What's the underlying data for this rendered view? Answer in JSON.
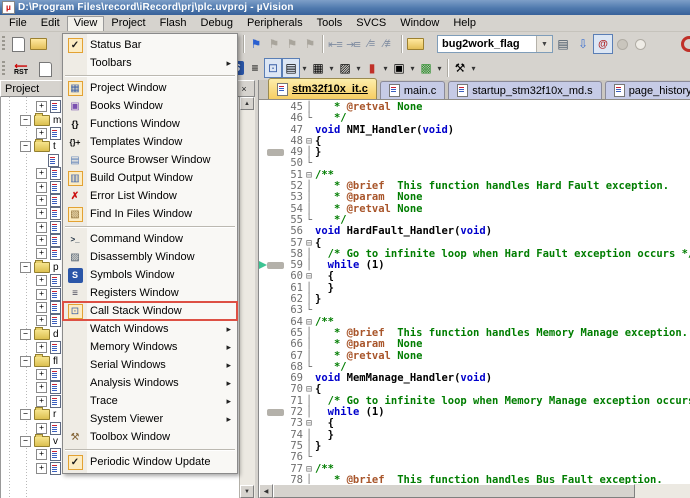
{
  "window": {
    "title": "D:\\Program Files\\record\\iRecord\\prj\\plc.uvproj - µVision"
  },
  "menubar": {
    "items": [
      "File",
      "Edit",
      "View",
      "Project",
      "Flash",
      "Debug",
      "Peripherals",
      "Tools",
      "SVCS",
      "Window",
      "Help"
    ],
    "active": "View"
  },
  "icons": {
    "check": "✓",
    "submenu-arrow": "▸",
    "flag": "⚑",
    "registers": "≡",
    "project": "▦",
    "books": "▣",
    "functions": "{}",
    "templates": "{}+",
    "source-browser": "▤",
    "build-output": "▥",
    "error-list": "✗",
    "find-in-files": "▧",
    "command": ">_",
    "disassembly": "▨",
    "symbols": "S",
    "call-stack": "⊡",
    "toolbox": "⚒",
    "pin": "↧",
    "close": "×",
    "up": "▲",
    "down": "▼",
    "left": "◀",
    "dropdown": "▾",
    "editmarkers": "≣",
    "grid": "▦",
    "watch": "▤",
    "memory": "▥",
    "serial": "▨",
    "analysis": "▮",
    "sysviewer": "▣",
    "chip": "▩",
    "wrench": "⚒",
    "docfind": "▤",
    "bluearrow": "⇩",
    "magat": "@",
    "newdoc": "",
    "openfolder": "",
    "loadfolder": "⚑"
  },
  "toolbar_main": {
    "combo_value": "bug2work_flag"
  },
  "toolbar_debug": {
    "rst_label": "RST"
  },
  "project_panel": {
    "title": "Project",
    "tree": [
      {
        "type": "file",
        "exp": "plus",
        "lvl": 2,
        "label": ""
      },
      {
        "type": "folder",
        "exp": "minus",
        "lvl": 1,
        "label": "m"
      },
      {
        "type": "file",
        "exp": "plus",
        "lvl": 2,
        "label": ""
      },
      {
        "type": "folder",
        "exp": "minus",
        "lvl": 1,
        "label": "t"
      },
      {
        "type": "file",
        "exp": null,
        "lvl": 2,
        "label": ""
      },
      {
        "type": "file",
        "exp": "plus",
        "lvl": 2,
        "label": ""
      },
      {
        "type": "file",
        "exp": "plus",
        "lvl": 2,
        "label": ""
      },
      {
        "type": "file",
        "exp": "plus",
        "lvl": 2,
        "label": ""
      },
      {
        "type": "file",
        "exp": "plus",
        "lvl": 2,
        "label": ""
      },
      {
        "type": "file",
        "exp": "plus",
        "lvl": 2,
        "label": ""
      },
      {
        "type": "file",
        "exp": "plus",
        "lvl": 2,
        "label": ""
      },
      {
        "type": "file",
        "exp": "plus",
        "lvl": 2,
        "label": ""
      },
      {
        "type": "folder",
        "exp": "minus",
        "lvl": 1,
        "label": "p"
      },
      {
        "type": "file",
        "exp": "plus",
        "lvl": 2,
        "label": ""
      },
      {
        "type": "file",
        "exp": "plus",
        "lvl": 2,
        "label": ""
      },
      {
        "type": "file",
        "exp": "plus",
        "lvl": 2,
        "label": ""
      },
      {
        "type": "file",
        "exp": "plus",
        "lvl": 2,
        "label": ""
      },
      {
        "type": "folder",
        "exp": "minus",
        "lvl": 1,
        "label": "d"
      },
      {
        "type": "file",
        "exp": "plus",
        "lvl": 2,
        "label": ""
      },
      {
        "type": "folder",
        "exp": "minus",
        "lvl": 1,
        "label": "fl"
      },
      {
        "type": "file",
        "exp": "plus",
        "lvl": 2,
        "label": ""
      },
      {
        "type": "file",
        "exp": "plus",
        "lvl": 2,
        "label": ""
      },
      {
        "type": "file",
        "exp": "plus",
        "lvl": 2,
        "label": ""
      },
      {
        "type": "folder",
        "exp": "minus",
        "lvl": 1,
        "label": "r"
      },
      {
        "type": "file",
        "exp": "plus",
        "lvl": 2,
        "label": ""
      },
      {
        "type": "folder",
        "exp": "minus",
        "lvl": 1,
        "label": "v"
      },
      {
        "type": "file",
        "exp": "plus",
        "lvl": 2,
        "label": ""
      },
      {
        "type": "file",
        "exp": "plus",
        "lvl": 2,
        "label": ""
      }
    ]
  },
  "editor": {
    "tabs": [
      {
        "label": "stm32f10x_it.c",
        "active": true
      },
      {
        "label": "main.c",
        "active": false
      },
      {
        "label": "startup_stm32f10x_md.s",
        "active": false
      },
      {
        "label": "page_history.c",
        "active": false
      }
    ],
    "lines": [
      {
        "n": 45,
        "fold": "v",
        "tok": [
          [
            "c",
            "   * "
          ],
          [
            "d",
            "@retval"
          ],
          [
            "c",
            " None"
          ]
        ]
      },
      {
        "n": 46,
        "fold": "e",
        "tok": [
          [
            "c",
            "   */"
          ]
        ]
      },
      {
        "n": 47,
        "fold": "",
        "tok": [
          [
            "k",
            "void"
          ],
          [
            "p",
            " NMI_Handler("
          ],
          [
            "k",
            "void"
          ],
          [
            "p",
            ")"
          ]
        ]
      },
      {
        "n": 48,
        "fold": "o",
        "tok": [
          [
            "p",
            "{"
          ]
        ]
      },
      {
        "n": 49,
        "fold": "v",
        "mark": "block",
        "tok": [
          [
            "p",
            "}"
          ]
        ]
      },
      {
        "n": 50,
        "fold": "e",
        "tok": []
      },
      {
        "n": 51,
        "fold": "o",
        "tok": [
          [
            "c",
            "/**"
          ]
        ]
      },
      {
        "n": 52,
        "fold": "v",
        "tok": [
          [
            "c",
            "   * "
          ],
          [
            "d",
            "@brief"
          ],
          [
            "c",
            "  This function handles Hard Fault exception."
          ]
        ]
      },
      {
        "n": 53,
        "fold": "v",
        "tok": [
          [
            "c",
            "   * "
          ],
          [
            "d",
            "@param"
          ],
          [
            "c",
            "  None"
          ]
        ]
      },
      {
        "n": 54,
        "fold": "v",
        "tok": [
          [
            "c",
            "   * "
          ],
          [
            "d",
            "@retval"
          ],
          [
            "c",
            " None"
          ]
        ]
      },
      {
        "n": 55,
        "fold": "e",
        "tok": [
          [
            "c",
            "   */"
          ]
        ]
      },
      {
        "n": 56,
        "fold": "",
        "tok": [
          [
            "k",
            "void"
          ],
          [
            "p",
            " HardFault_Handler("
          ],
          [
            "k",
            "void"
          ],
          [
            "p",
            ")"
          ]
        ]
      },
      {
        "n": 57,
        "fold": "o",
        "tok": [
          [
            "p",
            "{"
          ]
        ]
      },
      {
        "n": 58,
        "fold": "v",
        "tok": [
          [
            "c",
            "  /* Go to infinite loop when Hard Fault exception occurs */"
          ]
        ]
      },
      {
        "n": 59,
        "fold": "v",
        "mark": "arrow",
        "tok": [
          [
            "p",
            "  "
          ],
          [
            "k",
            "while"
          ],
          [
            "p",
            " (1)"
          ]
        ]
      },
      {
        "n": 60,
        "fold": "o",
        "tok": [
          [
            "p",
            "  {"
          ]
        ]
      },
      {
        "n": 61,
        "fold": "v",
        "tok": [
          [
            "p",
            "  }"
          ]
        ]
      },
      {
        "n": 62,
        "fold": "v",
        "tok": [
          [
            "p",
            "}"
          ]
        ]
      },
      {
        "n": 63,
        "fold": "e",
        "tok": []
      },
      {
        "n": 64,
        "fold": "o",
        "tok": [
          [
            "c",
            "/**"
          ]
        ]
      },
      {
        "n": 65,
        "fold": "v",
        "tok": [
          [
            "c",
            "   * "
          ],
          [
            "d",
            "@brief"
          ],
          [
            "c",
            "  This function handles Memory Manage exception."
          ]
        ]
      },
      {
        "n": 66,
        "fold": "v",
        "tok": [
          [
            "c",
            "   * "
          ],
          [
            "d",
            "@param"
          ],
          [
            "c",
            "  None"
          ]
        ]
      },
      {
        "n": 67,
        "fold": "v",
        "tok": [
          [
            "c",
            "   * "
          ],
          [
            "d",
            "@retval"
          ],
          [
            "c",
            " None"
          ]
        ]
      },
      {
        "n": 68,
        "fold": "e",
        "tok": [
          [
            "c",
            "   */"
          ]
        ]
      },
      {
        "n": 69,
        "fold": "",
        "tok": [
          [
            "k",
            "void"
          ],
          [
            "p",
            " MemManage_Handler("
          ],
          [
            "k",
            "void"
          ],
          [
            "p",
            ")"
          ]
        ]
      },
      {
        "n": 70,
        "fold": "o",
        "tok": [
          [
            "p",
            "{"
          ]
        ]
      },
      {
        "n": 71,
        "fold": "v",
        "tok": [
          [
            "c",
            "  /* Go to infinite loop when Memory Manage exception occurs */"
          ]
        ]
      },
      {
        "n": 72,
        "fold": "v",
        "mark": "block",
        "tok": [
          [
            "p",
            "  "
          ],
          [
            "k",
            "while"
          ],
          [
            "p",
            " (1)"
          ]
        ]
      },
      {
        "n": 73,
        "fold": "o",
        "tok": [
          [
            "p",
            "  {"
          ]
        ]
      },
      {
        "n": 74,
        "fold": "v",
        "tok": [
          [
            "p",
            "  }"
          ]
        ]
      },
      {
        "n": 75,
        "fold": "v",
        "tok": [
          [
            "p",
            "}"
          ]
        ]
      },
      {
        "n": 76,
        "fold": "e",
        "tok": []
      },
      {
        "n": 77,
        "fold": "o",
        "tok": [
          [
            "c",
            "/**"
          ]
        ]
      },
      {
        "n": 78,
        "fold": "v",
        "tok": [
          [
            "c",
            "   * "
          ],
          [
            "d",
            "@brief"
          ],
          [
            "c",
            "  This function handles Bus Fault exception."
          ]
        ]
      }
    ]
  },
  "view_menu": {
    "items": [
      {
        "label": "Status Bar",
        "icon": "check",
        "checked": true
      },
      {
        "label": "Toolbars",
        "submenu": true
      },
      {
        "sep": true
      },
      {
        "label": "Project Window",
        "icon": "project",
        "boxed": true
      },
      {
        "label": "Books Window",
        "icon": "books"
      },
      {
        "label": "Functions Window",
        "icon": "functions"
      },
      {
        "label": "Templates Window",
        "icon": "templates"
      },
      {
        "label": "Source Browser Window",
        "icon": "source-browser"
      },
      {
        "label": "Build Output Window",
        "icon": "build-output",
        "boxed": true
      },
      {
        "label": "Error List Window",
        "icon": "error-list"
      },
      {
        "label": "Find In Files Window",
        "icon": "find-in-files",
        "boxed": true
      },
      {
        "sep": true
      },
      {
        "label": "Command Window",
        "icon": "command"
      },
      {
        "label": "Disassembly Window",
        "icon": "disassembly"
      },
      {
        "label": "Symbols Window",
        "icon": "symbols"
      },
      {
        "label": "Registers Window",
        "icon": "registers"
      },
      {
        "label": "Call Stack Window",
        "icon": "call-stack",
        "boxed": true,
        "annotated": true
      },
      {
        "label": "Watch Windows",
        "submenu": true
      },
      {
        "label": "Memory Windows",
        "submenu": true
      },
      {
        "label": "Serial Windows",
        "submenu": true
      },
      {
        "label": "Analysis Windows",
        "submenu": true
      },
      {
        "label": "Trace",
        "submenu": true
      },
      {
        "label": "System Viewer",
        "submenu": true
      },
      {
        "label": "Toolbox Window",
        "icon": "toolbox"
      },
      {
        "sep": true
      },
      {
        "label": "Periodic Window Update",
        "icon": "check",
        "checked": true
      }
    ]
  }
}
